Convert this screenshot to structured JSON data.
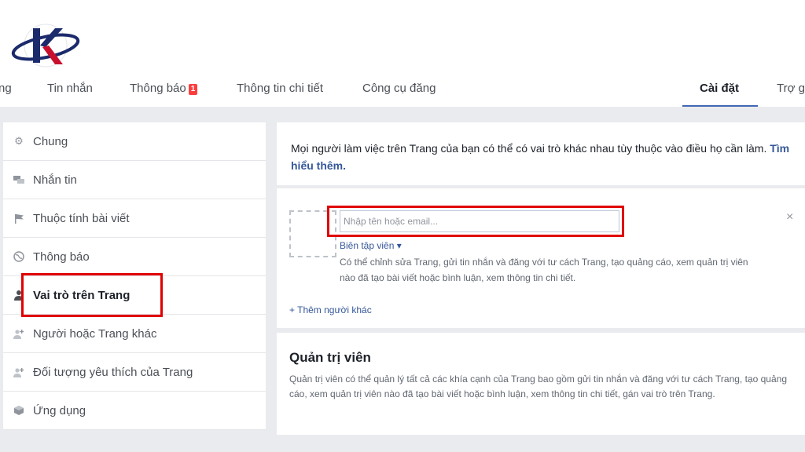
{
  "nav": {
    "tabs": [
      {
        "label": "ng"
      },
      {
        "label": "Tin nhắn"
      },
      {
        "label": "Thông báo",
        "badge": "1"
      },
      {
        "label": "Thông tin chi tiết"
      },
      {
        "label": "Công cụ đăng"
      },
      {
        "label": "Cài đặt",
        "active": true
      },
      {
        "label": "Trợ g"
      }
    ]
  },
  "sidebar": {
    "items": [
      {
        "label": "Chung",
        "icon": "gear-icon"
      },
      {
        "label": "Nhắn tin",
        "icon": "chat-icon"
      },
      {
        "label": "Thuộc tính bài viết",
        "icon": "flag-icon"
      },
      {
        "label": "Thông báo",
        "icon": "globe-icon"
      },
      {
        "label": "Vai trò trên Trang",
        "icon": "person-icon",
        "active": true
      },
      {
        "label": "Người hoặc Trang khác",
        "icon": "person-plus-icon"
      },
      {
        "label": "Đối tượng yêu thích của Trang",
        "icon": "person-plus-icon"
      },
      {
        "label": "Ứng dụng",
        "icon": "cube-icon"
      }
    ]
  },
  "main": {
    "intro_text": "Mọi người làm việc trên Trang của bạn có thể có vai trò khác nhau tùy thuộc vào điều họ cần làm.",
    "intro_link": "Tìm hiểu thêm.",
    "assign": {
      "input_placeholder": "Nhập tên hoặc email...",
      "role": "Biên tập viên ▾",
      "role_desc": "Có thể chỉnh sửa Trang, gửi tin nhắn và đăng với tư cách Trang, tạo quảng cáo, xem quản trị viên nào đã tạo bài viết hoặc bình luận, xem thông tin chi tiết.",
      "add_more": "+ Thêm người khác",
      "close": "×"
    },
    "admin": {
      "title": "Quản trị viên",
      "desc": "Quản trị viên có thể quản lý tất cả các khía cạnh của Trang bao gồm gửi tin nhắn và đăng với tư cách Trang, tạo quảng cáo, xem quản trị viên nào đã tạo bài viết hoặc bình luận, xem thông tin chi tiết, gán vai trò trên Trang."
    }
  },
  "colors": {
    "highlight": "#e00000",
    "link": "#365899",
    "accent": "#4267b2",
    "logo_navy": "#1b2a6b",
    "logo_red": "#c8102e"
  }
}
